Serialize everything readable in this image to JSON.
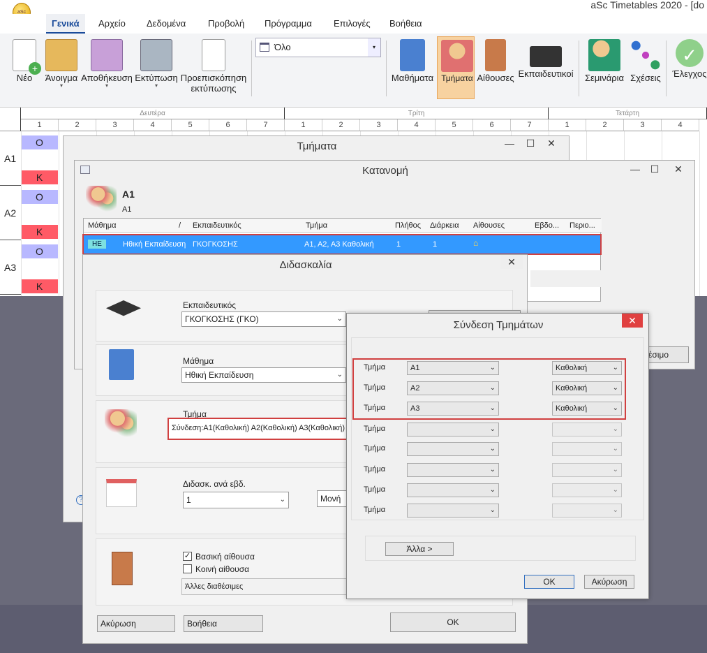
{
  "app": {
    "title": "aSc Timetables 2020  - [do"
  },
  "ribbon_tabs": [
    "Γενικά",
    "Αρχείο",
    "Δεδομένα",
    "Προβολή",
    "Πρόγραμμα",
    "Επιλογές",
    "Βοήθεια"
  ],
  "ribbon": {
    "new": "Νέο",
    "open": "Άνοιγμα",
    "save": "Αποθήκευση",
    "print": "Εκτύπωση",
    "preview1": "Προεπισκόπηση",
    "preview2": "εκτύπωσης",
    "filter_value": "Όλο",
    "subjects": "Μαθήματα",
    "classes": "Τμήματα",
    "rooms": "Αίθουσες",
    "teachers": "Εκπαιδευτικοί",
    "seminars": "Σεμινάρια",
    "relations": "Σχέσεις",
    "check": "Έλεγχος"
  },
  "grid": {
    "days": [
      "Δευτέρα",
      "Τρίτη",
      "Τετάρτη"
    ],
    "periods": [
      "1",
      "2",
      "3",
      "4",
      "5",
      "6",
      "7"
    ],
    "classes": [
      "A1",
      "A2",
      "A3"
    ],
    "cell_top": "O",
    "cell_bottom": "K"
  },
  "win_classes": {
    "title": "Τμήματα"
  },
  "win_allocation": {
    "title": "Κατανομή",
    "class_name": "A1",
    "class_sub": "A1",
    "columns": [
      "Μάθημα",
      "Εκπαιδευτικός",
      "Τμήμα",
      "Πλήθος",
      "Διάρκεια",
      "Αίθουσες",
      "Εβδο...",
      "Περιο..."
    ],
    "row": {
      "badge": "HE",
      "subject": "Ηθική Εκπαίδευση",
      "teacher": "ΓΚΟΓΚΟΣΗΣ",
      "class": "A1, A2, A3 Καθολική",
      "count": "1",
      "duration": "1"
    },
    "side_btn": "έσιμο"
  },
  "win_teaching": {
    "title": "Διδασκαλία",
    "teacher_label": "Εκπαιδευτικός",
    "teacher_value": "ΓΚΟΓΚΟΣΗΣ (ΓΚΟ)",
    "subject_label": "Μάθημα",
    "subject_value": "Ηθική Εκπαίδευση",
    "class_label": "Τμήμα",
    "class_value": "Σύνδεση:A1(Καθολική) A2(Καθολική) A3(Καθολική)",
    "perweek_label": "Διδασκ. ανά εβδ.",
    "perweek_value": "1",
    "single_value": "Μονή",
    "main_room": "Βασική αίθουσα",
    "common_room": "Κοινή αίθουσα",
    "other_rooms": "Άλλες διαθέσιμες",
    "cancel": "Ακύρωση",
    "help": "Βοήθεια",
    "ok": "OK"
  },
  "win_link": {
    "title": "Σύνδεση Τμημάτων",
    "row_label": "Τμήμα",
    "rows": [
      {
        "class": "A1",
        "group": "Καθολική"
      },
      {
        "class": "A2",
        "group": "Καθολική"
      },
      {
        "class": "A3",
        "group": "Καθολική"
      },
      {
        "class": "",
        "group": ""
      },
      {
        "class": "",
        "group": ""
      },
      {
        "class": "",
        "group": ""
      },
      {
        "class": "",
        "group": ""
      },
      {
        "class": "",
        "group": ""
      }
    ],
    "other": "Άλλα >",
    "ok": "OK",
    "cancel": "Ακύρωση"
  },
  "colors": {
    "accent": "#1a4b9a",
    "highlight_row": "#3399ff",
    "red_frame": "#d04040",
    "O_cell": "#b8b8ff",
    "K_cell": "#ff5a66"
  }
}
